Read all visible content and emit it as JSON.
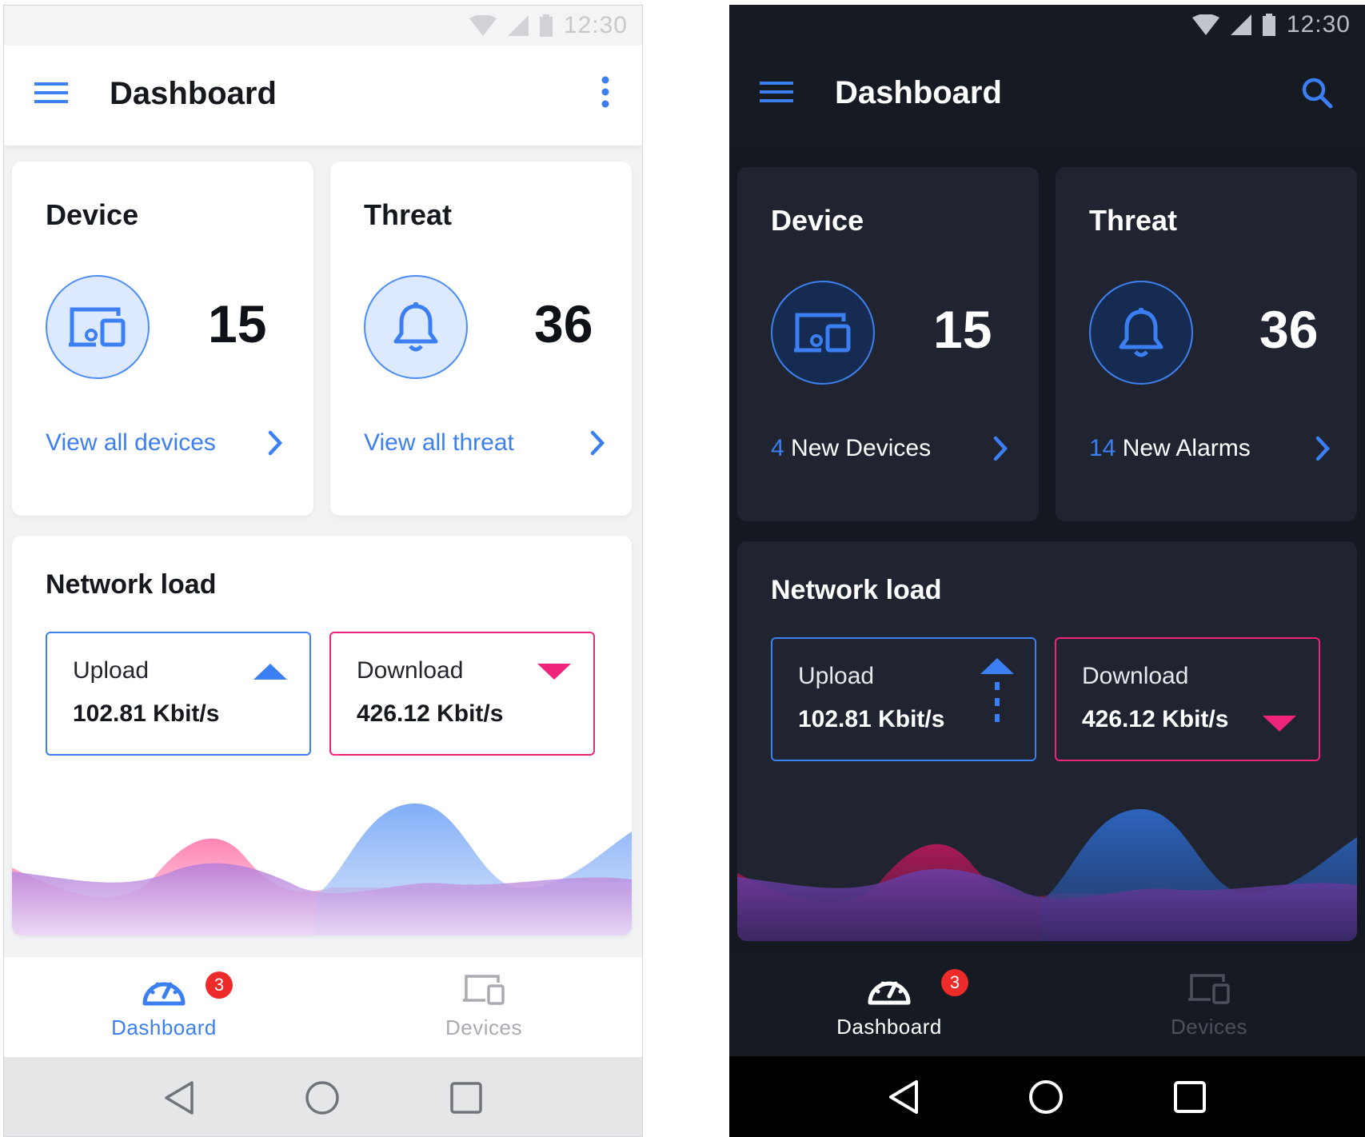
{
  "status": {
    "time": "12:30"
  },
  "light": {
    "appbar": {
      "title": "Dashboard",
      "menu_icon": "hamburger-menu-icon",
      "action_icon": "more-vert-icon"
    },
    "device_card": {
      "title": "Device",
      "count": "15",
      "link": "View all devices"
    },
    "threat_card": {
      "title": "Threat",
      "count": "36",
      "link": "View all threat"
    },
    "network": {
      "title": "Network load",
      "upload": {
        "label": "Upload",
        "value": "102.81 Kbit/s"
      },
      "download": {
        "label": "Download",
        "value": "426.12 Kbit/s"
      }
    },
    "bottom_nav": {
      "dashboard": "Dashboard",
      "devices": "Devices",
      "badge": "3"
    }
  },
  "dark": {
    "appbar": {
      "title": "Dashboard",
      "menu_icon": "hamburger-menu-icon",
      "action_icon": "search-icon"
    },
    "device_card": {
      "title": "Device",
      "count": "15",
      "link_num": "4",
      "link_text": " New Devices"
    },
    "threat_card": {
      "title": "Threat",
      "count": "36",
      "link_num": "14",
      "link_text": " New Alarms"
    },
    "network": {
      "title": "Network load",
      "upload": {
        "label": "Upload",
        "value": "102.81 Kbit/s"
      },
      "download": {
        "label": "Download",
        "value": "426.12 Kbit/s"
      }
    },
    "bottom_nav": {
      "dashboard": "Dashboard",
      "devices": "Devices",
      "badge": "3"
    }
  },
  "colors": {
    "accent": "#3b7ff2",
    "download": "#f0247d",
    "badge": "#ee2b2b"
  }
}
